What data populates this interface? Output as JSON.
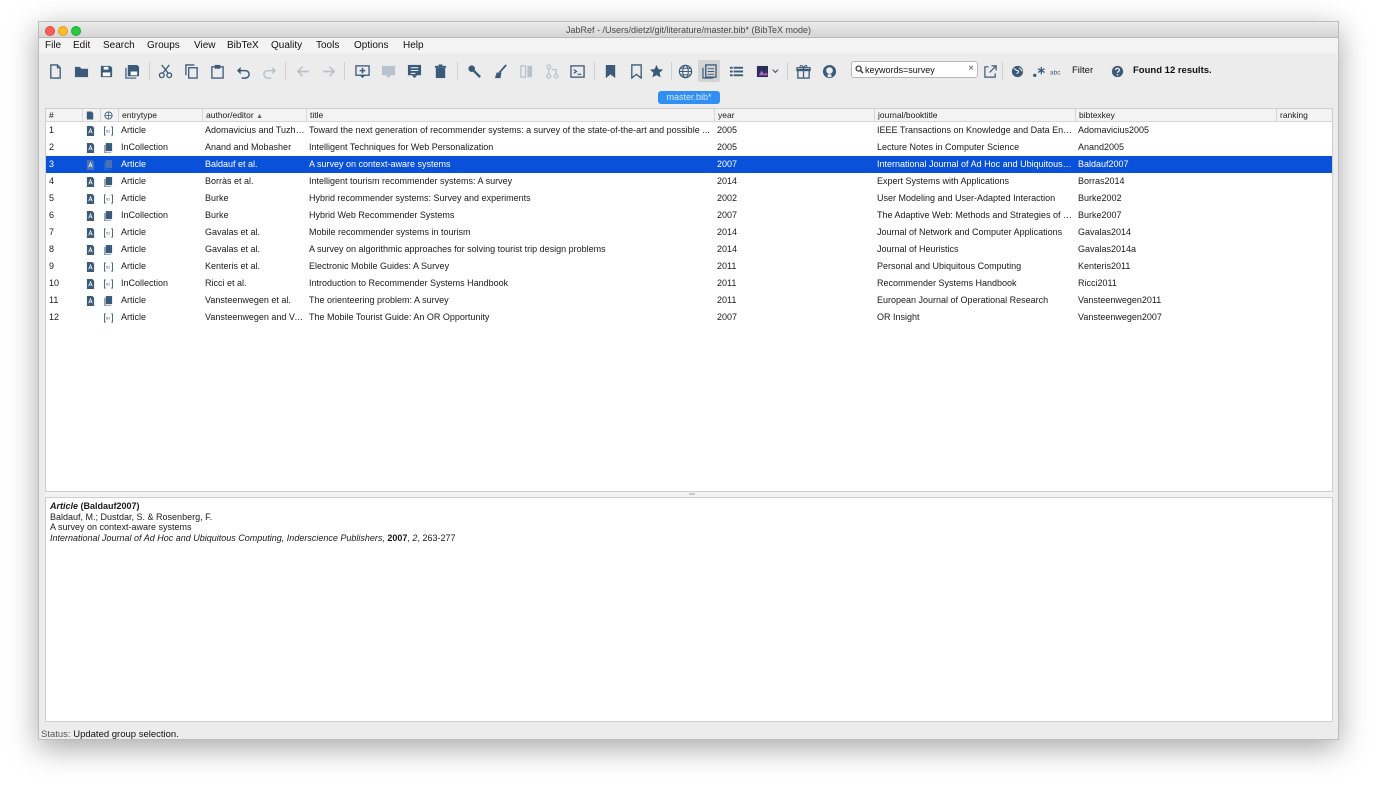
{
  "window": {
    "title": "JabRef - /Users/dietzl/git/literature/master.bib* (BibTeX mode)"
  },
  "menu": [
    "File",
    "Edit",
    "Search",
    "Groups",
    "View",
    "BibTeX",
    "Quality",
    "Tools",
    "Options",
    "Help"
  ],
  "toolbar": {
    "search_value": "keywords=survey",
    "clear_symbol": "×",
    "filter_label": "Filter",
    "found_label": "Found 12 results.",
    "icons": [
      "new-library-icon",
      "open-library-icon",
      "save-icon",
      "save-all-icon",
      "cut-icon",
      "copy-icon",
      "paste-icon",
      "undo-icon",
      "redo-icon",
      "back-icon",
      "forward-icon",
      "new-entry-icon",
      "new-entry-from-plaintext-icon",
      "edit-entry-icon",
      "delete-entry-icon",
      "search-key-icon",
      "cleanup-icon",
      "merge-icon",
      "split-icon",
      "terminal-icon",
      "mark-icon",
      "unmark-icon",
      "star-icon",
      "web-search-icon",
      "side-pane-icon",
      "table-icon",
      "preview-style-icon",
      "gift-icon",
      "github-icon",
      "open-external-icon",
      "globe-icon",
      "regex-icon",
      "case-sensitive-icon",
      "help-icon"
    ]
  },
  "tab": {
    "label": "master.bib*"
  },
  "table": {
    "columns": [
      "#",
      "",
      "",
      "entrytype",
      "author/editor",
      "title",
      "year",
      "journal/booktitle",
      "bibtexkey",
      "ranking"
    ],
    "sort_indicator": "▲",
    "rows": [
      {
        "n": "1",
        "pdf": true,
        "link": "doi",
        "entrytype": "Article",
        "author": "Adomavicius and Tuzhilin",
        "title": "Toward the next generation of recommender systems: a survey of the state-of-the-art and possible ...",
        "year": "2005",
        "journal": "IEEE Transactions on Knowledge and Data Engin...",
        "key": "Adomavicius2005"
      },
      {
        "n": "2",
        "pdf": true,
        "link": "book",
        "entrytype": "InCollection",
        "author": "Anand and Mobasher",
        "title": "Intelligent Techniques for Web Personalization",
        "year": "2005",
        "journal": "Lecture Notes in Computer Science",
        "key": "Anand2005"
      },
      {
        "n": "3",
        "pdf": true,
        "link": "book",
        "entrytype": "Article",
        "author": "Baldauf et al.",
        "title": "A survey on context-aware systems",
        "year": "2007",
        "journal": "International Journal of Ad Hoc and Ubiquitous C...",
        "key": "Baldauf2007",
        "selected": true
      },
      {
        "n": "4",
        "pdf": true,
        "link": "book",
        "entrytype": "Article",
        "author": "Borràs et al.",
        "title": "Intelligent tourism recommender systems: A survey",
        "year": "2014",
        "journal": "Expert Systems with Applications",
        "key": "Borras2014"
      },
      {
        "n": "5",
        "pdf": true,
        "link": "doi",
        "entrytype": "Article",
        "author": "Burke",
        "title": "Hybrid recommender systems: Survey and experiments",
        "year": "2002",
        "journal": "User Modeling and User-Adapted Interaction",
        "key": "Burke2002"
      },
      {
        "n": "6",
        "pdf": true,
        "link": "book",
        "entrytype": "InCollection",
        "author": "Burke",
        "title": "Hybrid Web Recommender Systems",
        "year": "2007",
        "journal": "The Adaptive Web: Methods and Strategies of W...",
        "key": "Burke2007"
      },
      {
        "n": "7",
        "pdf": true,
        "link": "doi",
        "entrytype": "Article",
        "author": "Gavalas et al.",
        "title": "Mobile recommender systems in tourism",
        "year": "2014",
        "journal": "Journal of Network and Computer Applications",
        "key": "Gavalas2014"
      },
      {
        "n": "8",
        "pdf": true,
        "link": "book",
        "entrytype": "Article",
        "author": "Gavalas et al.",
        "title": "A survey on algorithmic approaches for solving tourist trip design problems",
        "year": "2014",
        "journal": "Journal of Heuristics",
        "key": "Gavalas2014a"
      },
      {
        "n": "9",
        "pdf": true,
        "link": "doi",
        "entrytype": "Article",
        "author": "Kenteris et al.",
        "title": "Electronic Mobile Guides: A Survey",
        "year": "2011",
        "journal": "Personal and Ubiquitous Computing",
        "key": "Kenteris2011"
      },
      {
        "n": "10",
        "pdf": true,
        "link": "doi",
        "entrytype": "InCollection",
        "author": "Ricci et al.",
        "title": "Introduction to Recommender Systems Handbook",
        "year": "2011",
        "journal": "Recommender Systems Handbook",
        "key": "Ricci2011"
      },
      {
        "n": "11",
        "pdf": true,
        "link": "book",
        "entrytype": "Article",
        "author": "Vansteenwegen et al.",
        "title": "The orienteering problem: A survey",
        "year": "2011",
        "journal": "European Journal of Operational Research",
        "key": "Vansteenwegen2011"
      },
      {
        "n": "12",
        "pdf": false,
        "link": "doi",
        "entrytype": "Article",
        "author": "Vansteenwegen and Va...",
        "title": "The Mobile Tourist Guide: An OR Opportunity",
        "year": "2007",
        "journal": "OR Insight",
        "key": "Vansteenwegen2007"
      }
    ]
  },
  "preview": {
    "type": "Article",
    "key": "(Baldauf2007)",
    "authors": "Baldauf, M.; Dustdar, S. & Rosenberg, F.",
    "title": "A survey on context-aware systems",
    "journal": "International Journal of Ad Hoc and Ubiquitous Computing, Inderscience Publishers",
    "sep1": ", ",
    "year": "2007",
    "sep2": ", ",
    "volume": "2",
    "pages": ", 263-277"
  },
  "status": {
    "label": "Status:",
    "text": "Updated group selection."
  },
  "colors": {
    "selection": "#0a51d9",
    "tab": "#2f8ff5",
    "close": "#fc5f57",
    "minimize": "#fdbc2e",
    "maximize": "#28c840"
  }
}
